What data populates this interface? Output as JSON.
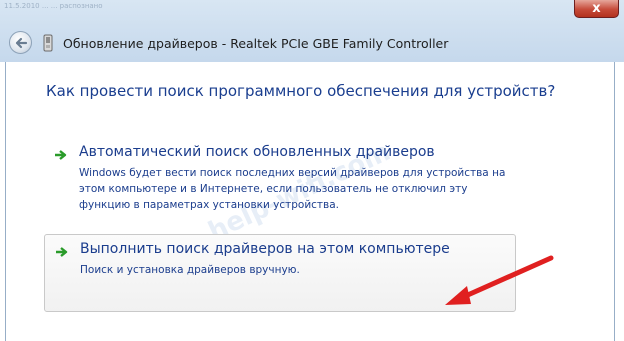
{
  "window": {
    "close_label": "x",
    "title": "Обновление драйверов - Realtek PCIe GBE Family Controller"
  },
  "background": {
    "ghost_text": "11.5.2010 ... ... распознано"
  },
  "main": {
    "heading": "Как провести поиск программного обеспечения для устройств?",
    "options": [
      {
        "title": "Автоматический поиск обновленных драйверов",
        "description": "Windows будет вести поиск последних версий драйверов для устройства на этом компьютере и в Интернете, если пользователь не отключил эту функцию в параметрах установки устройства."
      },
      {
        "title": "Выполнить поиск драйверов на этом компьютере",
        "description": "Поиск и установка драйверов вручную."
      }
    ]
  },
  "watermark": "help-wifi.com",
  "colors": {
    "link_blue": "#1b3d8d",
    "arrow_green": "#2a9b2a",
    "annotation_red": "#e02020"
  },
  "icons": {
    "back": "back-arrow-icon",
    "device": "device-icon",
    "option_arrow": "green-arrow-icon"
  }
}
